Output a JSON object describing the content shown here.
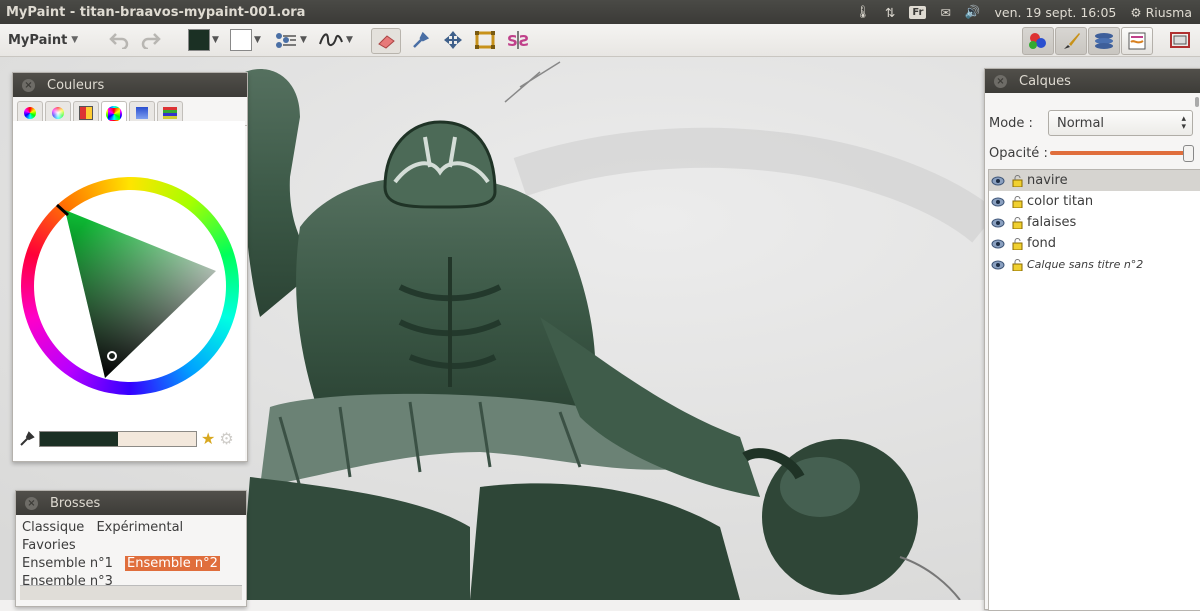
{
  "window": {
    "title": "MyPaint - titan-braavos-mypaint-001.ora",
    "keyboard_layout": "Fr",
    "clock": "ven. 19 sept. 16:05",
    "user": "Riusma"
  },
  "toolbar": {
    "app_menu": "MyPaint",
    "current_color": "#1b3024",
    "secondary_color": "#ffffff",
    "left_icons": [
      "undo-icon",
      "redo-icon",
      "color-swatch",
      "brush-settings-icon",
      "stroke-mode-icon",
      "eraser-icon",
      "color-picker-icon",
      "pan-icon",
      "frame-icon",
      "symmetry-icon"
    ],
    "right_icons": [
      "palette-icon",
      "brush-icon",
      "layers-icon",
      "scratchpad-icon",
      "fullscreen-icon"
    ]
  },
  "colors_panel": {
    "title": "Couleurs",
    "tabs": [
      "hsv-cube-icon",
      "hsv-wheel-icon",
      "palette-icon",
      "hsv-triangle-icon",
      "component-sliders-icon",
      "liquid-wash-icon"
    ],
    "active_tab": 3,
    "selected_color": "#1b3024",
    "history_color": "#f3e8dc"
  },
  "brushes_panel": {
    "title": "Brosses",
    "groups": [
      "Classique",
      "Expérimental",
      "Favories",
      "Ensemble n°1",
      "Ensemble n°2",
      "Ensemble n°3"
    ],
    "selected_group": "Ensemble n°2"
  },
  "layers_panel": {
    "title": "Calques",
    "mode_label": "Mode :",
    "mode_value": "Normal",
    "opacity_label": "Opacité :",
    "opacity": 1.0,
    "layers": [
      {
        "name": "navire",
        "selected": true,
        "italic": false
      },
      {
        "name": "color titan",
        "selected": false,
        "italic": false
      },
      {
        "name": "falaises",
        "selected": false,
        "italic": false
      },
      {
        "name": "fond",
        "selected": false,
        "italic": false
      },
      {
        "name": "Calque sans titre n°2",
        "selected": false,
        "italic": true
      }
    ]
  }
}
